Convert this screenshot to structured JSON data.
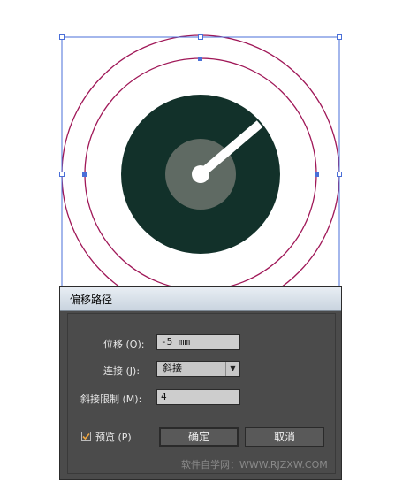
{
  "dialog": {
    "title": "偏移路径",
    "offset": {
      "label": "位移 (O):",
      "value": "-5 mm"
    },
    "joins": {
      "label": "连接 (J):",
      "value": "斜接"
    },
    "miter_limit": {
      "label": "斜接限制 (M):",
      "value": "4"
    },
    "preview": {
      "label": "预览 (P)",
      "checked": true
    },
    "ok_label": "确定",
    "cancel_label": "取消"
  },
  "watermark": "软件自学网：WWW.RJZXW.COM",
  "colors": {
    "selection": "#4a6fd8",
    "path_stroke": "#a01858",
    "dark_disc": "#12312a",
    "inner_disc": "#5f6a63",
    "dialog_bg": "#4b4b4b"
  }
}
